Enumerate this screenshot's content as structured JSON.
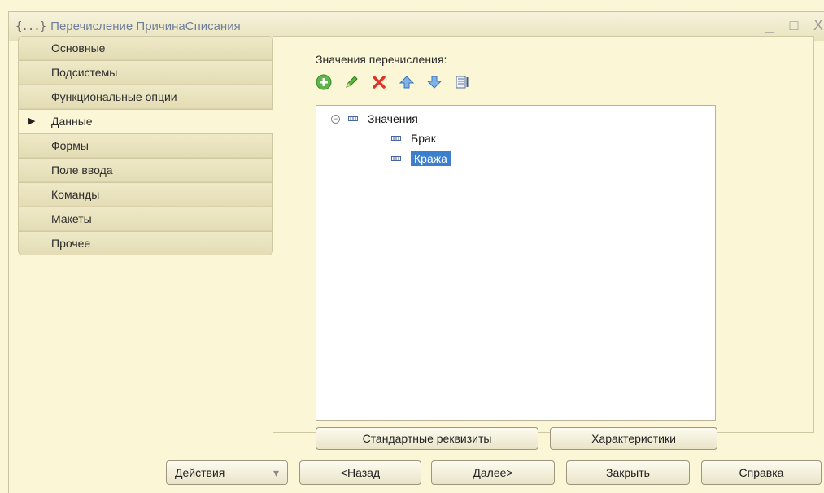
{
  "window": {
    "title": "Перечисление ПричинаСписания",
    "icon_glyph": "{...}",
    "controls": {
      "minimize": "_",
      "maximize": "□",
      "close": "X"
    }
  },
  "tabs": [
    {
      "label": "Основные",
      "active": false
    },
    {
      "label": "Подсистемы",
      "active": false
    },
    {
      "label": "Функциональные опции",
      "active": false
    },
    {
      "label": "Данные",
      "active": true
    },
    {
      "label": "Формы",
      "active": false
    },
    {
      "label": "Поле ввода",
      "active": false
    },
    {
      "label": "Команды",
      "active": false
    },
    {
      "label": "Макеты",
      "active": false
    },
    {
      "label": "Прочее",
      "active": false
    }
  ],
  "content": {
    "label": "Значения перечисления:",
    "toolbar": [
      "add-icon",
      "edit-icon",
      "delete-icon",
      "move-up-icon",
      "move-down-icon",
      "sort-list-icon"
    ],
    "tree": {
      "root": "Значения",
      "expander": "−",
      "items": [
        {
          "label": "Брак",
          "selected": false
        },
        {
          "label": "Кража",
          "selected": true
        }
      ]
    },
    "buttons": {
      "standard_attrs": "Стандартные реквизиты",
      "characteristics": "Характеристики"
    }
  },
  "footer": {
    "actions": "Действия",
    "actions_arrow": "▾",
    "back": "<Назад",
    "next": "Далее>",
    "close": "Закрыть",
    "help": "Справка"
  },
  "colors": {
    "background": "#fbf7d6",
    "tab": "#e8e2be",
    "selection": "#3d7fcf",
    "title_text": "#6f7f9a"
  }
}
